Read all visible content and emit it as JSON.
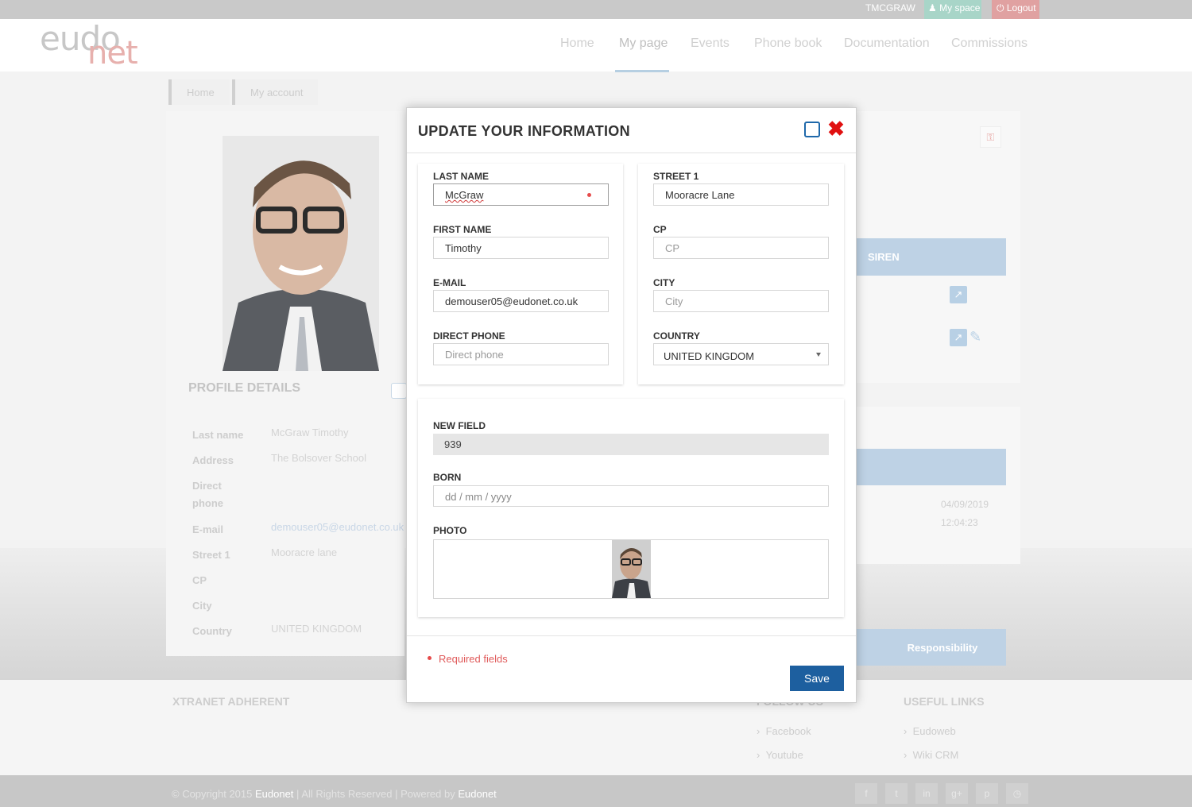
{
  "topbar": {
    "user": "TMCGRAW",
    "myspace": "My space",
    "logout": "Logout"
  },
  "logo": {
    "part1": "eudo",
    "part2": "net"
  },
  "nav": {
    "items": [
      "Home",
      "My page",
      "Events",
      "Phone book",
      "Documentation",
      "Commissions"
    ],
    "active": "My page"
  },
  "breadcrumb": [
    "Home",
    "My account"
  ],
  "profile": {
    "title": "PROFILE DETAILS",
    "rows": [
      {
        "label": "Last name",
        "value": "McGraw Timothy"
      },
      {
        "label": "Address",
        "value": "The Bolsover School"
      },
      {
        "label": "Direct phone",
        "value": ""
      },
      {
        "label": "E-mail",
        "value": "demouser05@eudonet.co.uk"
      },
      {
        "label": "Street 1",
        "value": "Mooracre lane"
      },
      {
        "label": "CP",
        "value": ""
      },
      {
        "label": "City",
        "value": ""
      },
      {
        "label": "Country",
        "value": "UNITED KINGDOM"
      }
    ]
  },
  "right_panel": {
    "siren": "SIREN",
    "date": "04/09/2019",
    "time": "12:04:23",
    "responsibility": "Responsibility"
  },
  "footer": {
    "xtranet": "XTRANET ADHERENT",
    "follow": "FOLLOW US",
    "follow_links": [
      "Facebook",
      "Youtube"
    ],
    "useful": "USEFUL LINKS",
    "useful_links": [
      "Eudoweb",
      "Wiki CRM"
    ],
    "copyright_pre": "© Copyright 2015",
    "brand1": "Eudonet",
    "copyright_mid": "| All Rights Reserved | Powered by",
    "brand2": "Eudonet",
    "social": [
      "f",
      "t",
      "in",
      "g+",
      "p",
      "◷"
    ]
  },
  "modal": {
    "title": "UPDATE YOUR INFORMATION",
    "fields": {
      "last_name": {
        "label": "LAST NAME",
        "value": "McGraw",
        "required": true
      },
      "first_name": {
        "label": "FIRST NAME",
        "value": "Timothy"
      },
      "email": {
        "label": "E-MAIL",
        "value": "demouser05@eudonet.co.uk"
      },
      "direct_phone": {
        "label": "DIRECT PHONE",
        "placeholder": "Direct phone"
      },
      "street1": {
        "label": "STREET 1",
        "value": "Mooracre Lane"
      },
      "cp": {
        "label": "CP",
        "placeholder": "CP"
      },
      "city": {
        "label": "CITY",
        "placeholder": "City"
      },
      "country": {
        "label": "COUNTRY",
        "value": "UNITED KINGDOM"
      },
      "new_field": {
        "label": "NEW FIELD",
        "value": "939"
      },
      "born": {
        "label": "BORN",
        "placeholder": "dd / mm / yyyy"
      },
      "photo": {
        "label": "PHOTO"
      }
    },
    "required_note": "Required fields",
    "save": "Save"
  },
  "colors": {
    "accent": "#1d5f9f",
    "close": "#e01010",
    "required": "#e64b4b",
    "light_blue": "#bed2e5"
  },
  "icons": [
    "user-icon",
    "power-icon",
    "maximize-icon",
    "close-icon",
    "key-icon",
    "open-link-icon",
    "edit-icon"
  ]
}
